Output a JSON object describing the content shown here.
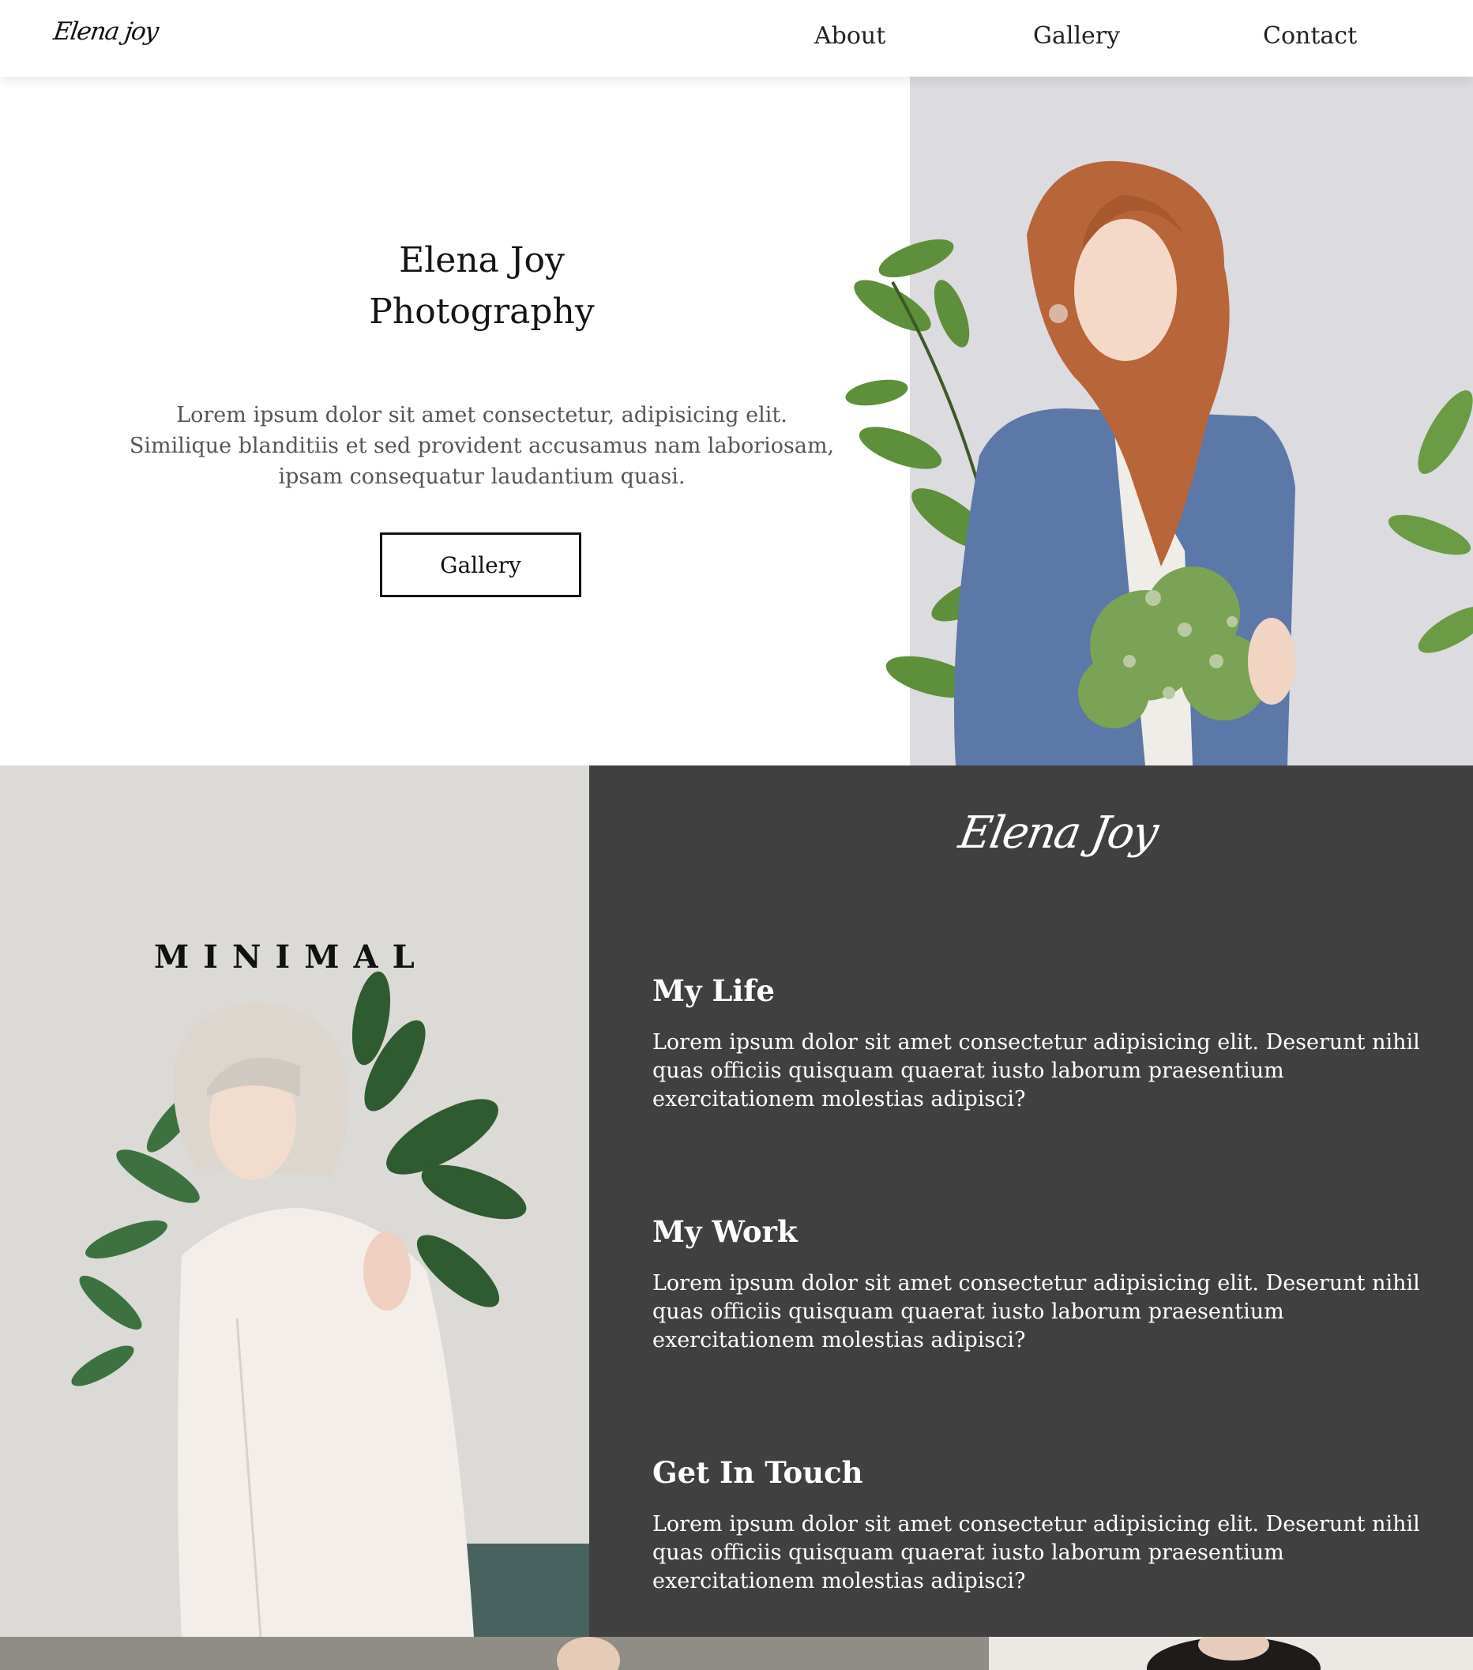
{
  "nav": {
    "logo": "Elena joy",
    "links": [
      "About",
      "Gallery",
      "Contact"
    ]
  },
  "hero": {
    "title_line1": "Elena Joy",
    "title_line2": "Photography",
    "text": "Lorem ipsum dolor sit amet consectetur, adipisicing elit. Similique blanditiis et sed provident accusamus nam laboriosam, ipsam consequatur laudantium quasi.",
    "button": "Gallery"
  },
  "feature": {
    "overlay_word": "MINIMAL",
    "script_logo": "Elena Joy",
    "sections": [
      {
        "heading": "My Life",
        "text": "Lorem ipsum dolor sit amet consectetur adipisicing elit. Deserunt nihil quas officiis quisquam quaerat iusto laborum praesentium exercitationem molestias adipisci?"
      },
      {
        "heading": "My Work",
        "text": "Lorem ipsum dolor sit amet consectetur adipisicing elit. Deserunt nihil quas officiis quisquam quaerat iusto laborum praesentium exercitationem molestias adipisci?"
      },
      {
        "heading": "Get In Touch",
        "text": "Lorem ipsum dolor sit amet consectetur adipisicing elit. Deserunt nihil quas officiis quisquam quaerat iusto laborum praesentium exercitationem molestias adipisci?"
      }
    ]
  },
  "colors": {
    "dark_panel": "#404040",
    "hero_photo_bg": "#dcdbe0",
    "sweater": "#5b78a8",
    "hair": "#b8653a",
    "leaf": "#5e8f3a"
  }
}
